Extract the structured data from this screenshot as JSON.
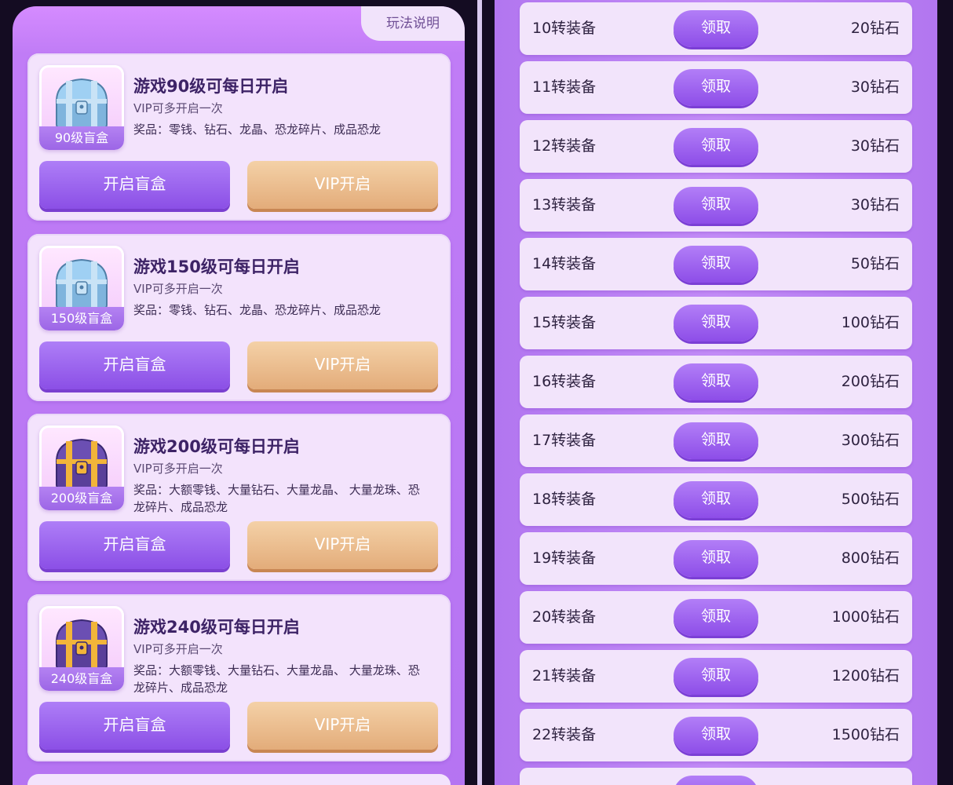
{
  "left": {
    "help_tab": "玩法说明",
    "cards": [
      {
        "title": "游戏90级可每日开启",
        "vip_note": "VIP可多开启一次",
        "prizes": "奖品：零钱、钻石、龙晶、恐龙碎片、成品恐龙",
        "chest_label": "90级盲盒",
        "chest_type": "blue",
        "open_label": "开启盲盒",
        "vip_label": "VIP开启"
      },
      {
        "title": "游戏150级可每日开启",
        "vip_note": "VIP可多开启一次",
        "prizes": "奖品：零钱、钻石、龙晶、恐龙碎片、成品恐龙",
        "chest_label": "150级盲盒",
        "chest_type": "blue",
        "open_label": "开启盲盒",
        "vip_label": "VIP开启"
      },
      {
        "title": "游戏200级可每日开启",
        "vip_note": "VIP可多开启一次",
        "prizes": "奖品：大额零钱、大量钻石、大量龙晶、 大量龙珠、恐龙碎片、成品恐龙",
        "chest_label": "200级盲盒",
        "chest_type": "gold",
        "open_label": "开启盲盒",
        "vip_label": "VIP开启"
      },
      {
        "title": "游戏240级可每日开启",
        "vip_note": "VIP可多开启一次",
        "prizes": "奖品：大额零钱、大量钻石、大量龙晶、 大量龙珠、恐龙碎片、成品恐龙",
        "chest_label": "240级盲盒",
        "chest_type": "gold",
        "open_label": "开启盲盒",
        "vip_label": "VIP开启"
      }
    ]
  },
  "right": {
    "claim_label": "领取",
    "rows": [
      {
        "label": "10转装备",
        "reward": "20钻石"
      },
      {
        "label": "11转装备",
        "reward": "30钻石"
      },
      {
        "label": "12转装备",
        "reward": "30钻石"
      },
      {
        "label": "13转装备",
        "reward": "30钻石"
      },
      {
        "label": "14转装备",
        "reward": "50钻石"
      },
      {
        "label": "15转装备",
        "reward": "100钻石"
      },
      {
        "label": "16转装备",
        "reward": "200钻石"
      },
      {
        "label": "17转装备",
        "reward": "300钻石"
      },
      {
        "label": "18转装备",
        "reward": "500钻石"
      },
      {
        "label": "19转装备",
        "reward": "800钻石"
      },
      {
        "label": "20转装备",
        "reward": "1000钻石"
      },
      {
        "label": "21转装备",
        "reward": "1200钻石"
      },
      {
        "label": "22转装备",
        "reward": "1500钻石"
      }
    ]
  },
  "colors": {
    "primary_purple": "#8b4fe6",
    "vip_orange": "#e3ac7a",
    "card_bg": "#f3e3fc",
    "panel_bg": "#b574f2"
  }
}
